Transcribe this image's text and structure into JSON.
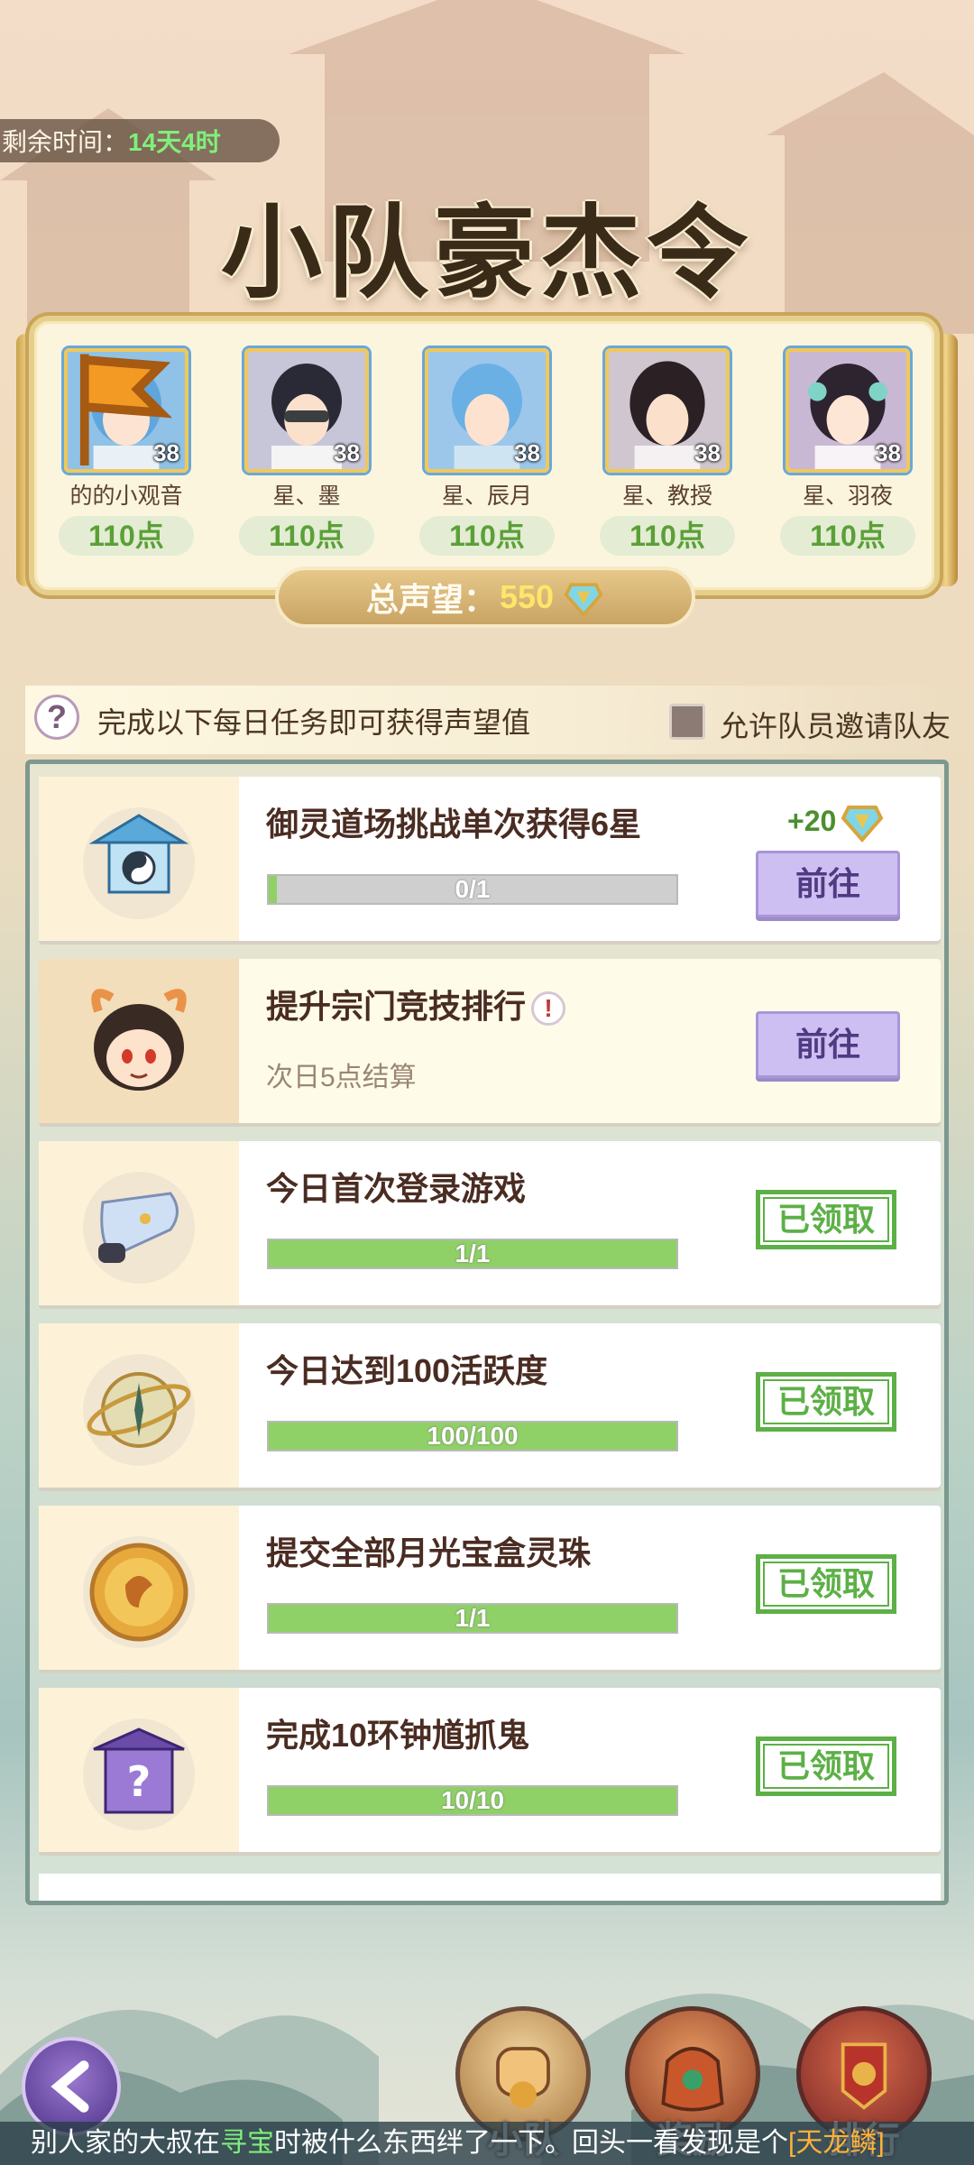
{
  "timer": {
    "label": "剩余时间：",
    "value": "14天4时"
  },
  "page_title": "小队豪杰令",
  "members": [
    {
      "name": "的的小观音",
      "level": "38",
      "points": "110点"
    },
    {
      "name": "星、墨",
      "level": "38",
      "points": "110点"
    },
    {
      "name": "星、辰月",
      "level": "38",
      "points": "110点"
    },
    {
      "name": "星、教授",
      "level": "38",
      "points": "110点"
    },
    {
      "name": "星、羽夜",
      "level": "38",
      "points": "110点"
    }
  ],
  "total": {
    "label": "总声望：",
    "value": "550"
  },
  "info": {
    "help_glyph": "?",
    "text": "完成以下每日任务即可获得声望值",
    "checkbox_label": "允许队员邀请队友"
  },
  "tasks": [
    {
      "name": "御灵道场挑战单次获得6星",
      "progress_text": "0/1",
      "progress": 0.02,
      "reward": "+20",
      "button": "前往",
      "icon": "pavilion-icon"
    },
    {
      "name": "提升宗门竞技排行",
      "sub": "次日5点结算",
      "alert": "!",
      "button": "前往",
      "icon": "demon-avatar-icon"
    },
    {
      "name": "今日首次登录游戏",
      "progress_text": "1/1",
      "progress": 1,
      "status": "已领取",
      "icon": "scroll-icon"
    },
    {
      "name": "今日达到100活跃度",
      "progress_text": "100/100",
      "progress": 1,
      "status": "已领取",
      "icon": "compass-icon"
    },
    {
      "name": "提交全部月光宝盒灵珠",
      "progress_text": "1/1",
      "progress": 1,
      "status": "已领取",
      "icon": "coin-icon"
    },
    {
      "name": "完成10环钟馗抓鬼",
      "progress_text": "10/10",
      "progress": 1,
      "status": "已领取",
      "icon": "mystery-box-icon"
    }
  ],
  "nav": {
    "team": "小队",
    "reward": "奖励",
    "rank": "排行"
  },
  "ticker": {
    "p1": "别人家的大叔在",
    "h1": "寻宝",
    "p2": "时被什么东西绊了一下。回头一看发现是个",
    "h2": "[天龙鳞]"
  },
  "colors": {
    "progress_fill": "#8fd067",
    "claimed": "#5cb046",
    "go_button": "#cdbff2"
  }
}
